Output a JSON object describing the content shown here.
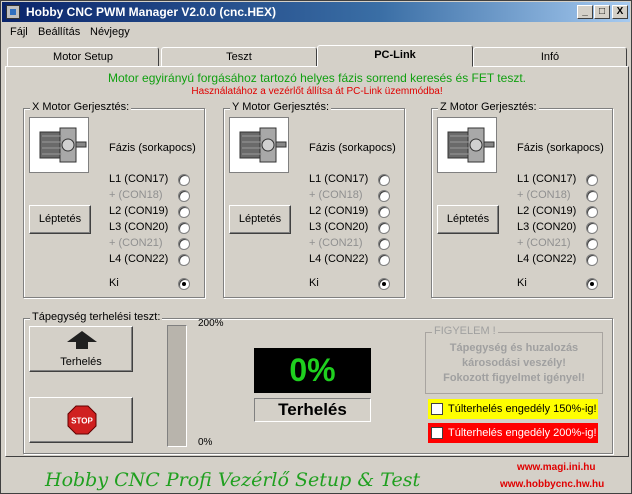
{
  "window": {
    "title": "Hobby CNC PWM Manager V2.0.0    (cnc.HEX)"
  },
  "titlebar_buttons": {
    "minimize": "_",
    "maximize": "□",
    "close": "X"
  },
  "menu": [
    "Fájl",
    "Beállítás",
    "Névjegy"
  ],
  "tabs": [
    {
      "label": "Motor Setup",
      "active": false
    },
    {
      "label": "Teszt",
      "active": false
    },
    {
      "label": "PC-Link",
      "active": true
    },
    {
      "label": "Infó",
      "active": false
    }
  ],
  "messages": {
    "main": "Motor egyirányú forgásához tartozó helyes fázis sorrend keresés és FET teszt.",
    "sub": "Használatához a vezérlőt állítsa át PC-Link üzemmódba!"
  },
  "motors": [
    {
      "legend": "X Motor Gerjesztés:",
      "phase_header": "Fázis (sorkapocs)",
      "step_button": "Léptetés",
      "rows": [
        {
          "label": "L1 (CON17)",
          "enabled": true,
          "selected": false
        },
        {
          "label": "+  (CON18)",
          "enabled": false,
          "selected": false
        },
        {
          "label": "L2 (CON19)",
          "enabled": true,
          "selected": false
        },
        {
          "label": "L3 (CON20)",
          "enabled": true,
          "selected": false
        },
        {
          "label": "+  (CON21)",
          "enabled": false,
          "selected": false
        },
        {
          "label": "L4 (CON22)",
          "enabled": true,
          "selected": false
        },
        {
          "label": "Ki",
          "enabled": true,
          "selected": true
        }
      ]
    },
    {
      "legend": "Y Motor Gerjesztés:",
      "phase_header": "Fázis (sorkapocs)",
      "step_button": "Léptetés",
      "rows": [
        {
          "label": "L1 (CON17)",
          "enabled": true,
          "selected": false
        },
        {
          "label": "+  (CON18)",
          "enabled": false,
          "selected": false
        },
        {
          "label": "L2 (CON19)",
          "enabled": true,
          "selected": false
        },
        {
          "label": "L3 (CON20)",
          "enabled": true,
          "selected": false
        },
        {
          "label": "+  (CON21)",
          "enabled": false,
          "selected": false
        },
        {
          "label": "L4 (CON22)",
          "enabled": true,
          "selected": false
        },
        {
          "label": "Ki",
          "enabled": true,
          "selected": true
        }
      ]
    },
    {
      "legend": "Z Motor Gerjesztés:",
      "phase_header": "Fázis (sorkapocs)",
      "step_button": "Léptetés",
      "rows": [
        {
          "label": "L1 (CON17)",
          "enabled": true,
          "selected": false
        },
        {
          "label": "+  (CON18)",
          "enabled": false,
          "selected": false
        },
        {
          "label": "L2 (CON19)",
          "enabled": true,
          "selected": false
        },
        {
          "label": "L3 (CON20)",
          "enabled": true,
          "selected": false
        },
        {
          "label": "+  (CON21)",
          "enabled": false,
          "selected": false
        },
        {
          "label": "L4 (CON22)",
          "enabled": true,
          "selected": false
        },
        {
          "label": "Ki",
          "enabled": true,
          "selected": true
        }
      ]
    }
  ],
  "power_test": {
    "legend": "Tápegység terhelési teszt:",
    "load_button": "Terhelés",
    "stop_label": "STOP",
    "scale_max": "200%",
    "scale_min": "0%",
    "percent": "0%",
    "load_level": 0,
    "status_label": "Terhelés"
  },
  "warning": {
    "legend": "FIGYELEM !",
    "lines": [
      "Tápegység és huzalozás",
      "károsodási veszély!",
      "Fokozott figyelmet igényel!"
    ]
  },
  "overload_options": [
    {
      "label": "Túlterhelés engedély 150%-ig!",
      "color": "#ffff00",
      "checked": false
    },
    {
      "label": "Túlterhelés engedély 200%-ig!",
      "color": "#ff0000",
      "checked": false
    }
  ],
  "footer": {
    "title": "Hobby CNC Profi Vezérlő Setup & Test",
    "url1": "www.magi.ini.hu",
    "url2": "www.hobbycnc.hw.hu"
  },
  "colors": {
    "title_gradient_start": "#0a246a",
    "message_green": "#10a010",
    "message_red": "#e00000",
    "percent_green": "#1fd01f"
  }
}
